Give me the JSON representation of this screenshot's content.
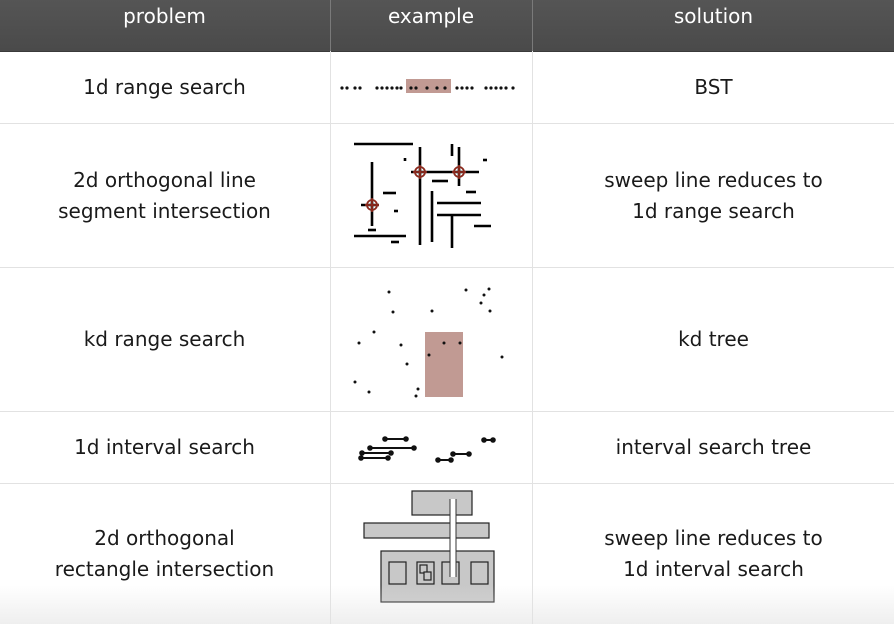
{
  "header": {
    "col1": "problem",
    "col2": "example",
    "col3": "solution"
  },
  "rows": [
    {
      "problem": [
        "1d range search"
      ],
      "solution": [
        "BST"
      ],
      "example_icon": "1d-range-search-illustration"
    },
    {
      "problem": [
        "2d orthogonal line",
        "segment intersection"
      ],
      "solution": [
        "sweep line reduces to",
        "1d range search"
      ],
      "example_icon": "line-segment-intersection-illustration"
    },
    {
      "problem": [
        "kd range search"
      ],
      "solution": [
        "kd tree"
      ],
      "example_icon": "kd-range-search-illustration"
    },
    {
      "problem": [
        "1d interval search"
      ],
      "solution": [
        "interval search tree"
      ],
      "example_icon": "interval-search-illustration"
    },
    {
      "problem": [
        "2d orthogonal",
        "rectangle intersection"
      ],
      "solution": [
        "sweep line reduces to",
        "1d interval search"
      ],
      "example_icon": "rectangle-intersection-illustration"
    }
  ],
  "colors": {
    "header_bg": "#4f4f4f",
    "highlight": "#c19a93",
    "intersection_marker": "#8b2a1e",
    "rect_fill": "#c8c8c8"
  }
}
